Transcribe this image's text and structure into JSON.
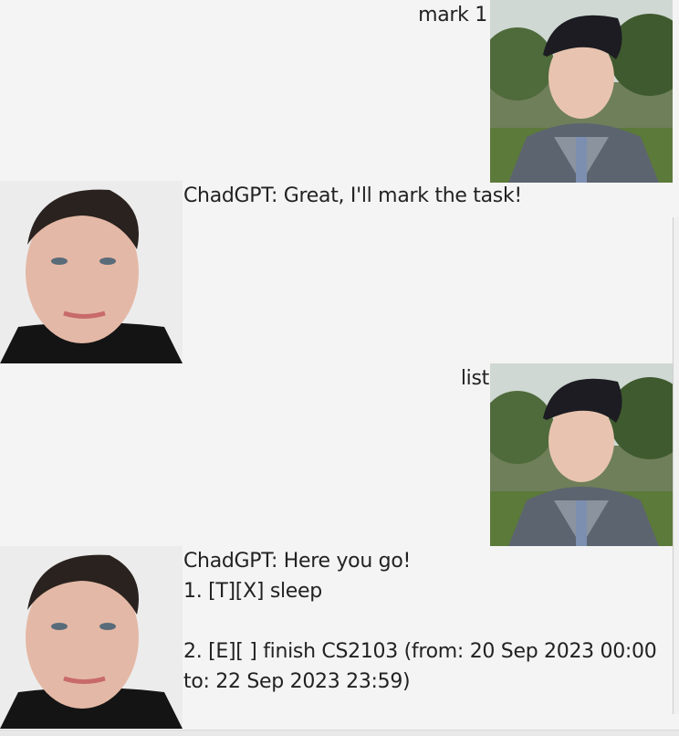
{
  "dialog": [
    {
      "speaker": "user",
      "text": "mark 1",
      "avatar": "user-avatar-photo"
    },
    {
      "speaker": "bot",
      "text": "ChadGPT: Great, I'll mark the task!",
      "avatar": "bot-avatar-photo"
    },
    {
      "speaker": "user",
      "text": "list",
      "avatar": "user-avatar-photo"
    },
    {
      "speaker": "bot",
      "lines": [
        "ChadGPT: Here you go!",
        "1. [T][X] sleep",
        "",
        "2. [E][ ] finish CS2103 (from: 20 Sep 2023 00:00",
        "to: 22 Sep 2023 23:59)"
      ],
      "avatar": "bot-avatar-photo"
    }
  ]
}
